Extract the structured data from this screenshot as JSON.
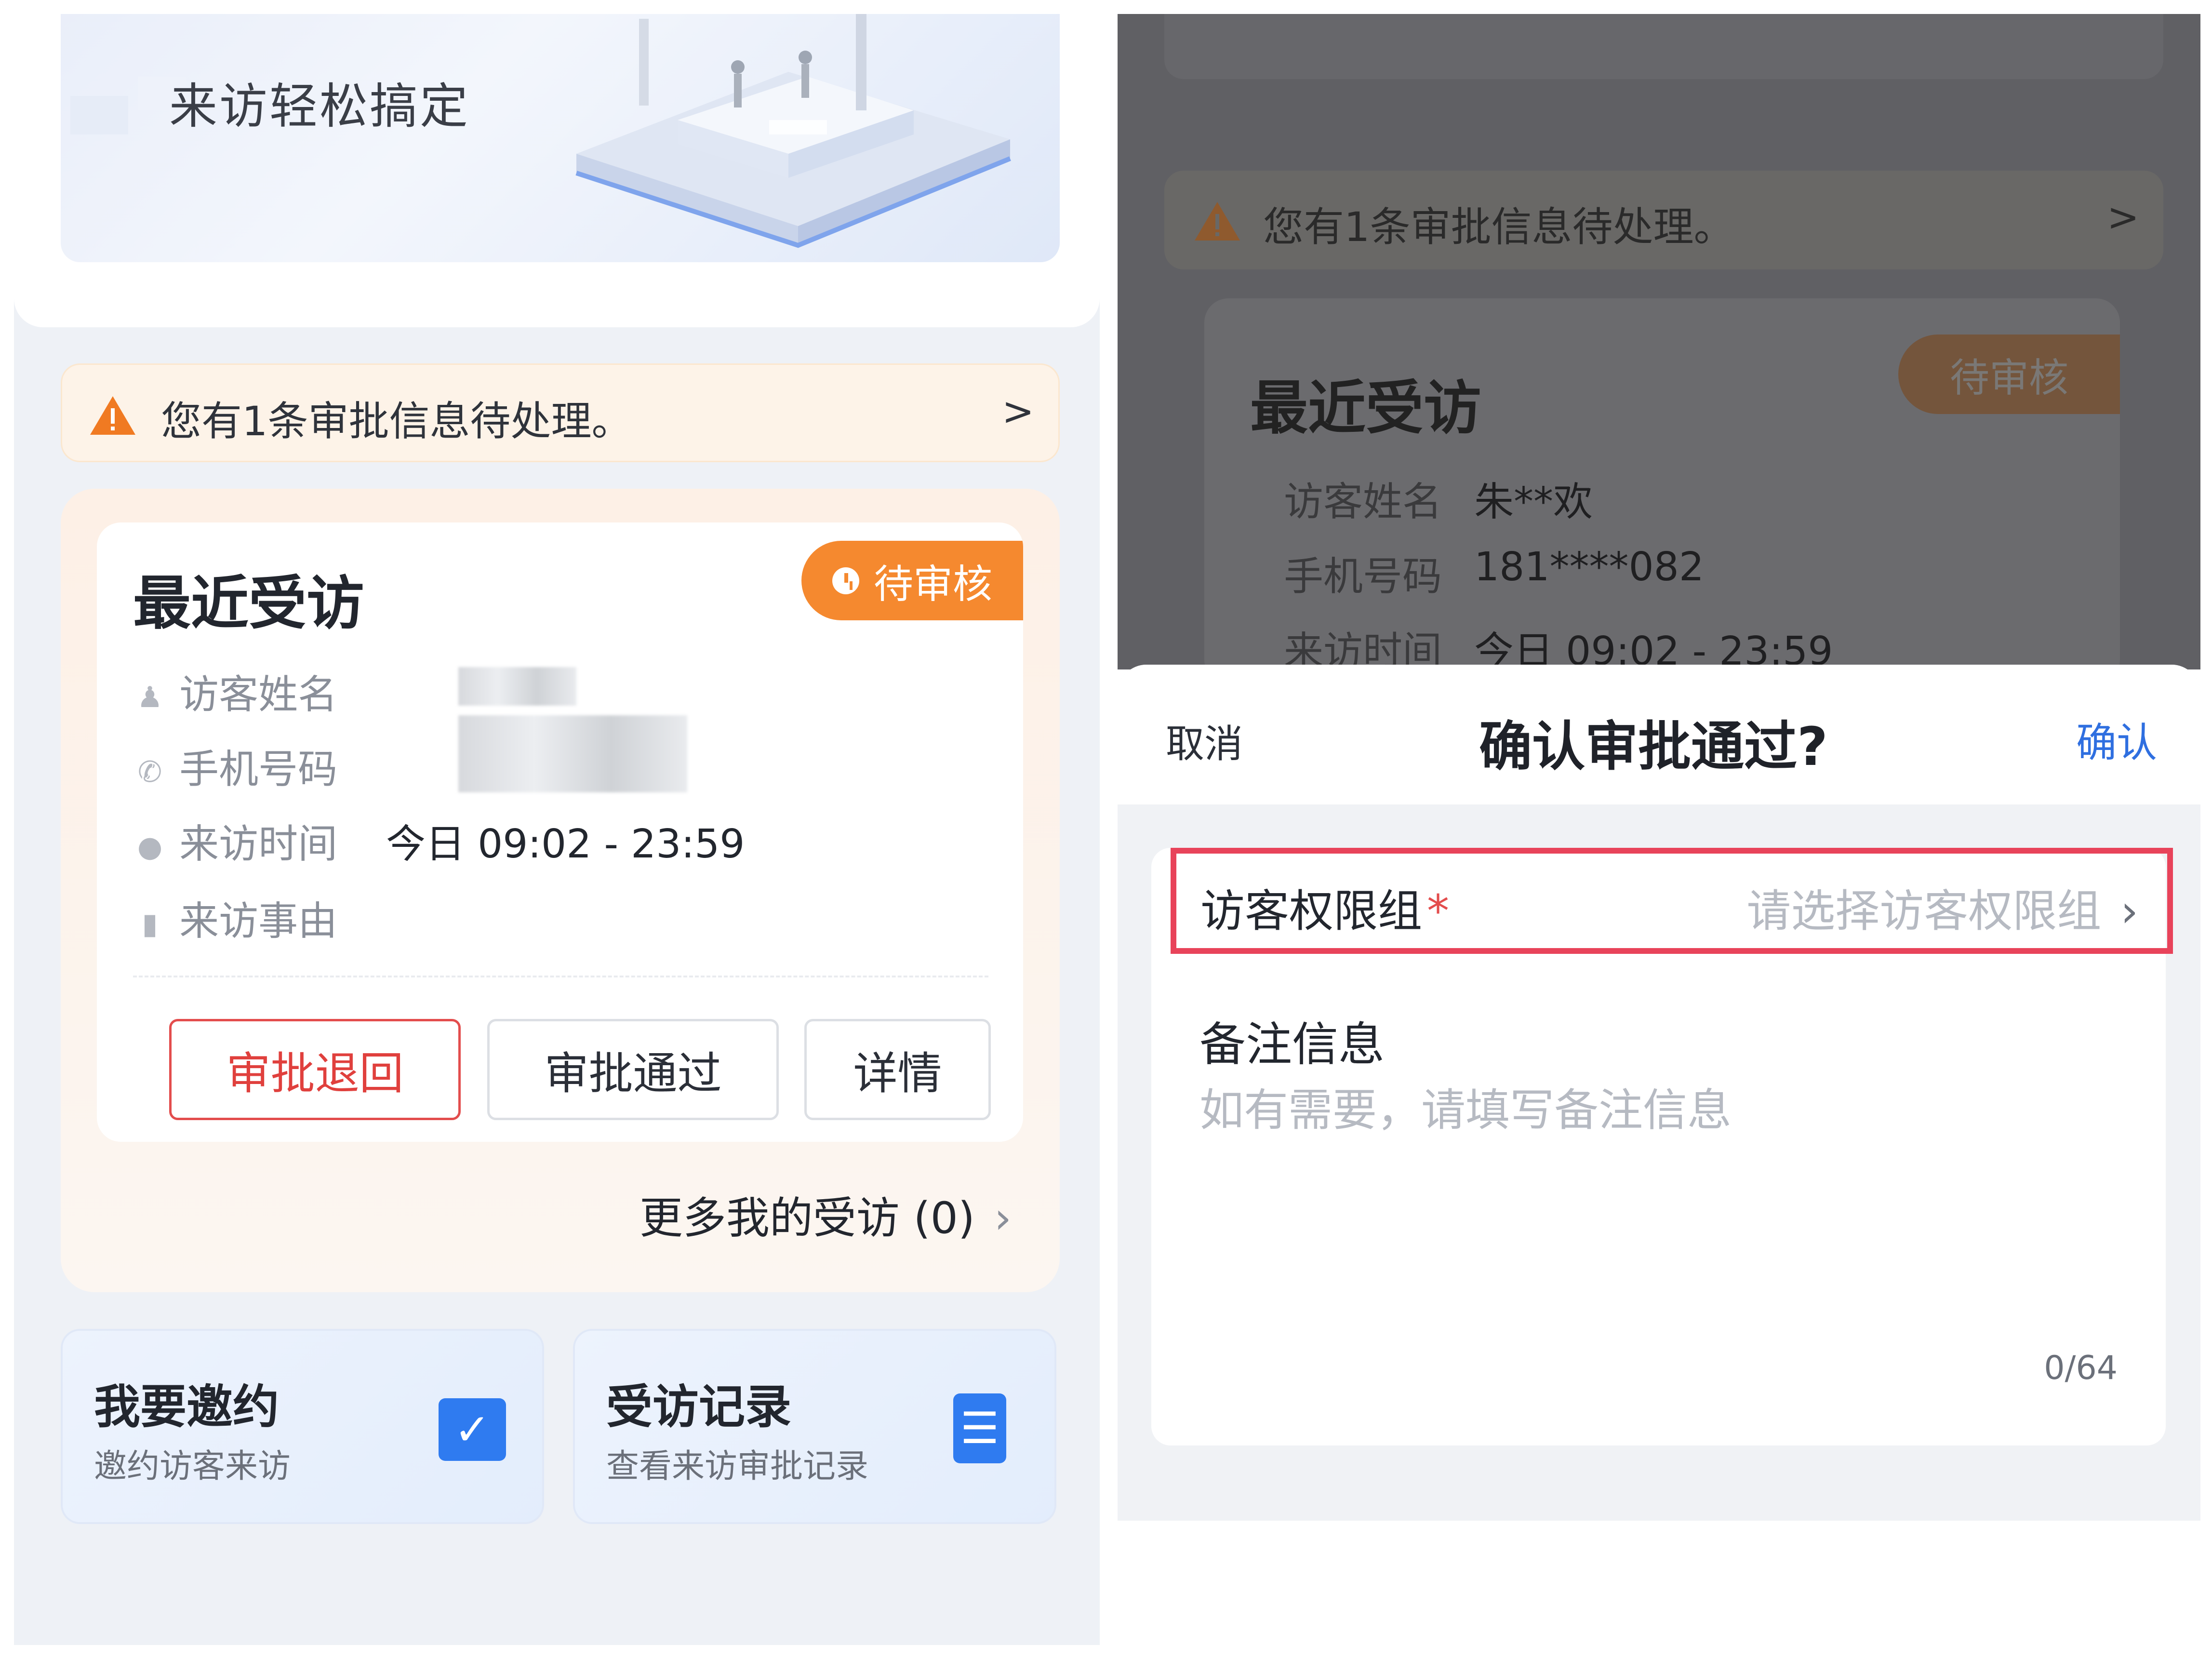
{
  "left": {
    "hero": {
      "title_partial": "来访轻松搞定",
      "subtitle": "来访轻松搞定"
    },
    "notice": {
      "icon": "warning-icon",
      "text": "您有1条审批信息待处理。",
      "arrow": ">"
    },
    "visit_card": {
      "title": "最近受访",
      "status": "待审核",
      "fields": [
        {
          "icon": "user-icon",
          "label": "访客姓名",
          "value": ""
        },
        {
          "icon": "phone-icon",
          "label": "手机号码",
          "value": ""
        },
        {
          "icon": "clock-icon",
          "label": "来访时间",
          "value": "今日 09:02 - 23:59"
        },
        {
          "icon": "document-icon",
          "label": "来访事由",
          "value": ""
        }
      ],
      "buttons": {
        "reject": "审批退回",
        "approve": "审批通过",
        "detail": "详情"
      }
    },
    "more_link": "更多我的受访 (0)",
    "quick_actions": [
      {
        "title": "我要邀约",
        "subtitle": "邀约访客来访",
        "icon": "calendar-check-icon"
      },
      {
        "title": "受访记录",
        "subtitle": "查看来访审批记录",
        "icon": "document-list-icon"
      }
    ]
  },
  "right": {
    "background": {
      "notice_text": "您有1条审批信息待处理。",
      "notice_arrow": ">",
      "card_title": "最近受访",
      "status": "待审核",
      "fields": [
        {
          "label": "访客姓名",
          "value": "朱**欢"
        },
        {
          "label": "手机号码",
          "value": "181****082"
        },
        {
          "label": "来访时间",
          "value": "今日 09:02 - 23:59"
        }
      ]
    },
    "sheet": {
      "cancel": "取消",
      "title": "确认审批通过?",
      "confirm": "确认",
      "permission_label": "访客权限组",
      "required_mark": "*",
      "permission_placeholder": "请选择访客权限组",
      "note_label": "备注信息",
      "note_placeholder": "如有需要，请填写备注信息",
      "note_value": "",
      "counter": "0/64"
    }
  },
  "colors": {
    "accent_orange": "#f5892f",
    "reject_red": "#e0403d",
    "link_blue": "#2f6fe0",
    "highlight_red": "#e8435a",
    "quick_icon_blue": "#2f7bf0"
  }
}
